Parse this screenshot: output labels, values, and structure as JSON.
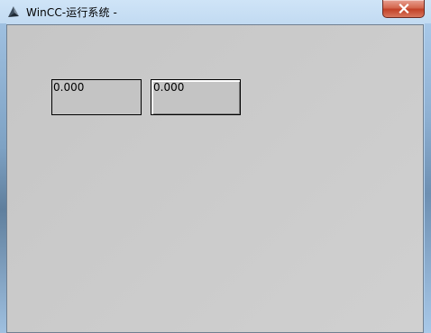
{
  "window": {
    "title": "WinCC-运行系统 -",
    "app_icon": "wincc-app-icon",
    "close_icon": "close-icon",
    "close_button_color": "#c9452c"
  },
  "client": {
    "background_color": "#c8c8c8",
    "io_fields": [
      {
        "value": "0.000"
      },
      {
        "value": "0.000"
      }
    ]
  }
}
